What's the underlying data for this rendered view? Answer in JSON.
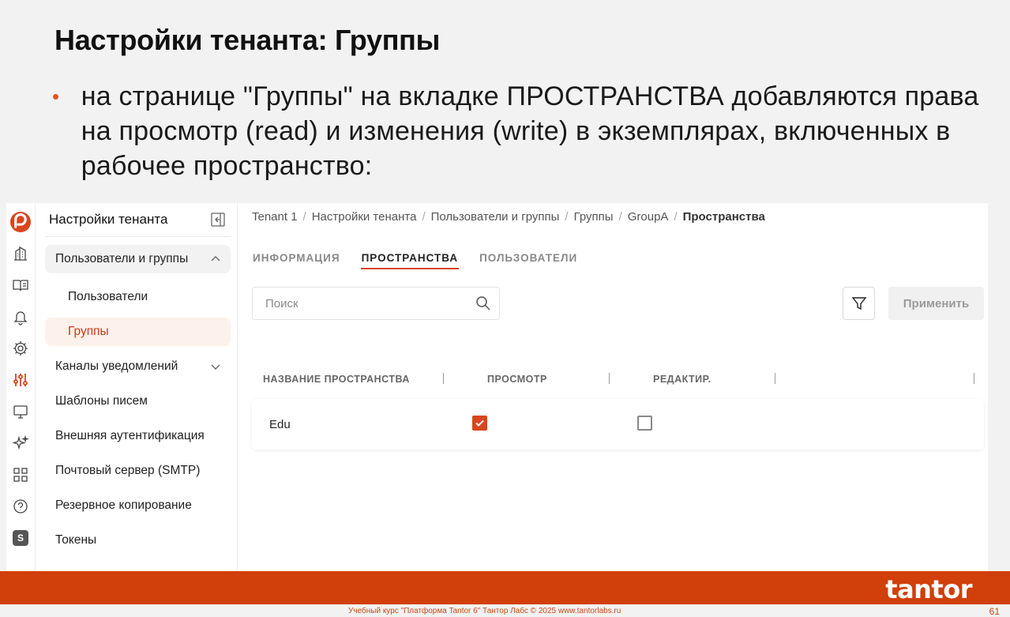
{
  "slide": {
    "title": "Настройки тенанта: Группы",
    "bullet": "на странице \"Группы\" на вкладке ПРОСТРАНСТВА добавляются права на просмотр (read) и изменения (write) в экземплярах, включенных в рабочее пространство:"
  },
  "sidebar": {
    "title": "Настройки тенанта",
    "items": [
      {
        "label": "Пользователи и группы"
      },
      {
        "label": "Пользователи"
      },
      {
        "label": "Группы"
      },
      {
        "label": "Каналы уведомлений"
      },
      {
        "label": "Шаблоны писем"
      },
      {
        "label": "Внешняя аутентификация"
      },
      {
        "label": "Почтовый сервер (SMTP)"
      },
      {
        "label": "Резервное копирование"
      },
      {
        "label": "Токены"
      }
    ]
  },
  "rail": {
    "icons": [
      "logo-icon",
      "building-icon",
      "book-icon",
      "bell-icon",
      "gear-icon",
      "sliders-icon",
      "monitor-icon",
      "sparkle-icon",
      "grid-icon",
      "help-icon",
      "s-badge-icon"
    ],
    "s_badge": "S",
    "accent": "#d8461e"
  },
  "breadcrumb": {
    "items": [
      "Tenant 1",
      "Настройки тенанта",
      "Пользователи и группы",
      "Группы",
      "GroupA",
      "Пространства"
    ],
    "sep": "/"
  },
  "tabs": [
    {
      "label": "ИНФОРМАЦИЯ"
    },
    {
      "label": "ПРОСТРАНСТВА"
    },
    {
      "label": "ПОЛЬЗОВАТЕЛИ"
    }
  ],
  "search": {
    "placeholder": "Поиск",
    "value": ""
  },
  "toolbar": {
    "apply_label": "Применить"
  },
  "table": {
    "columns": [
      "НАЗВАНИЕ ПРОСТРАНСТВА",
      "ПРОСМОТР",
      "РЕДАКТИР."
    ],
    "rows": [
      {
        "name": "Edu",
        "read": true,
        "write": false
      }
    ]
  },
  "footer": {
    "brand": "tantor",
    "text": "Учебный курс \"Платформа Tantor 6\" Тантор Лабс © 2025 www.tantorlabs.ru",
    "page": "61",
    "color": "#d13f0a"
  }
}
